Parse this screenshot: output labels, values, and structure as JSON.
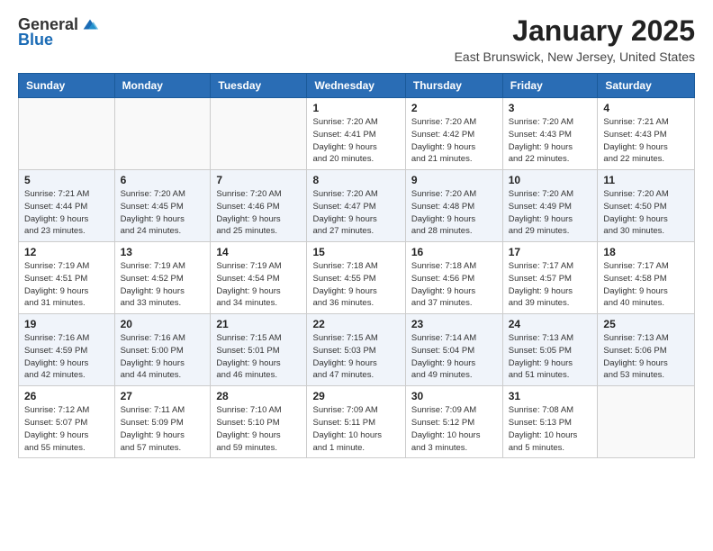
{
  "logo": {
    "general": "General",
    "blue": "Blue"
  },
  "header": {
    "month": "January 2025",
    "location": "East Brunswick, New Jersey, United States"
  },
  "weekdays": [
    "Sunday",
    "Monday",
    "Tuesday",
    "Wednesday",
    "Thursday",
    "Friday",
    "Saturday"
  ],
  "weeks": [
    [
      {
        "day": "",
        "info": ""
      },
      {
        "day": "",
        "info": ""
      },
      {
        "day": "",
        "info": ""
      },
      {
        "day": "1",
        "info": "Sunrise: 7:20 AM\nSunset: 4:41 PM\nDaylight: 9 hours\nand 20 minutes."
      },
      {
        "day": "2",
        "info": "Sunrise: 7:20 AM\nSunset: 4:42 PM\nDaylight: 9 hours\nand 21 minutes."
      },
      {
        "day": "3",
        "info": "Sunrise: 7:20 AM\nSunset: 4:43 PM\nDaylight: 9 hours\nand 22 minutes."
      },
      {
        "day": "4",
        "info": "Sunrise: 7:21 AM\nSunset: 4:43 PM\nDaylight: 9 hours\nand 22 minutes."
      }
    ],
    [
      {
        "day": "5",
        "info": "Sunrise: 7:21 AM\nSunset: 4:44 PM\nDaylight: 9 hours\nand 23 minutes."
      },
      {
        "day": "6",
        "info": "Sunrise: 7:20 AM\nSunset: 4:45 PM\nDaylight: 9 hours\nand 24 minutes."
      },
      {
        "day": "7",
        "info": "Sunrise: 7:20 AM\nSunset: 4:46 PM\nDaylight: 9 hours\nand 25 minutes."
      },
      {
        "day": "8",
        "info": "Sunrise: 7:20 AM\nSunset: 4:47 PM\nDaylight: 9 hours\nand 27 minutes."
      },
      {
        "day": "9",
        "info": "Sunrise: 7:20 AM\nSunset: 4:48 PM\nDaylight: 9 hours\nand 28 minutes."
      },
      {
        "day": "10",
        "info": "Sunrise: 7:20 AM\nSunset: 4:49 PM\nDaylight: 9 hours\nand 29 minutes."
      },
      {
        "day": "11",
        "info": "Sunrise: 7:20 AM\nSunset: 4:50 PM\nDaylight: 9 hours\nand 30 minutes."
      }
    ],
    [
      {
        "day": "12",
        "info": "Sunrise: 7:19 AM\nSunset: 4:51 PM\nDaylight: 9 hours\nand 31 minutes."
      },
      {
        "day": "13",
        "info": "Sunrise: 7:19 AM\nSunset: 4:52 PM\nDaylight: 9 hours\nand 33 minutes."
      },
      {
        "day": "14",
        "info": "Sunrise: 7:19 AM\nSunset: 4:54 PM\nDaylight: 9 hours\nand 34 minutes."
      },
      {
        "day": "15",
        "info": "Sunrise: 7:18 AM\nSunset: 4:55 PM\nDaylight: 9 hours\nand 36 minutes."
      },
      {
        "day": "16",
        "info": "Sunrise: 7:18 AM\nSunset: 4:56 PM\nDaylight: 9 hours\nand 37 minutes."
      },
      {
        "day": "17",
        "info": "Sunrise: 7:17 AM\nSunset: 4:57 PM\nDaylight: 9 hours\nand 39 minutes."
      },
      {
        "day": "18",
        "info": "Sunrise: 7:17 AM\nSunset: 4:58 PM\nDaylight: 9 hours\nand 40 minutes."
      }
    ],
    [
      {
        "day": "19",
        "info": "Sunrise: 7:16 AM\nSunset: 4:59 PM\nDaylight: 9 hours\nand 42 minutes."
      },
      {
        "day": "20",
        "info": "Sunrise: 7:16 AM\nSunset: 5:00 PM\nDaylight: 9 hours\nand 44 minutes."
      },
      {
        "day": "21",
        "info": "Sunrise: 7:15 AM\nSunset: 5:01 PM\nDaylight: 9 hours\nand 46 minutes."
      },
      {
        "day": "22",
        "info": "Sunrise: 7:15 AM\nSunset: 5:03 PM\nDaylight: 9 hours\nand 47 minutes."
      },
      {
        "day": "23",
        "info": "Sunrise: 7:14 AM\nSunset: 5:04 PM\nDaylight: 9 hours\nand 49 minutes."
      },
      {
        "day": "24",
        "info": "Sunrise: 7:13 AM\nSunset: 5:05 PM\nDaylight: 9 hours\nand 51 minutes."
      },
      {
        "day": "25",
        "info": "Sunrise: 7:13 AM\nSunset: 5:06 PM\nDaylight: 9 hours\nand 53 minutes."
      }
    ],
    [
      {
        "day": "26",
        "info": "Sunrise: 7:12 AM\nSunset: 5:07 PM\nDaylight: 9 hours\nand 55 minutes."
      },
      {
        "day": "27",
        "info": "Sunrise: 7:11 AM\nSunset: 5:09 PM\nDaylight: 9 hours\nand 57 minutes."
      },
      {
        "day": "28",
        "info": "Sunrise: 7:10 AM\nSunset: 5:10 PM\nDaylight: 9 hours\nand 59 minutes."
      },
      {
        "day": "29",
        "info": "Sunrise: 7:09 AM\nSunset: 5:11 PM\nDaylight: 10 hours\nand 1 minute."
      },
      {
        "day": "30",
        "info": "Sunrise: 7:09 AM\nSunset: 5:12 PM\nDaylight: 10 hours\nand 3 minutes."
      },
      {
        "day": "31",
        "info": "Sunrise: 7:08 AM\nSunset: 5:13 PM\nDaylight: 10 hours\nand 5 minutes."
      },
      {
        "day": "",
        "info": ""
      }
    ]
  ]
}
